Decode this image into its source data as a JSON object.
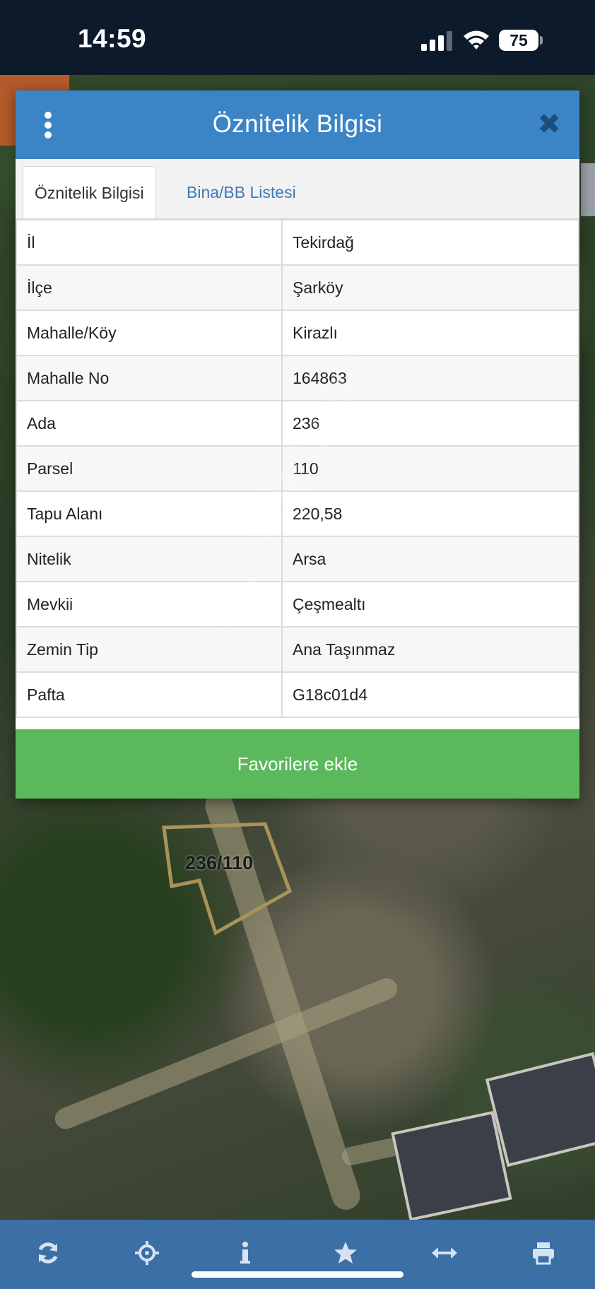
{
  "status_bar": {
    "time": "14:59",
    "battery": "75"
  },
  "modal": {
    "title": "Öznitelik Bilgisi",
    "tabs": [
      {
        "label": "Öznitelik Bilgisi",
        "active": true
      },
      {
        "label": "Bina/BB Listesi",
        "active": false
      }
    ],
    "rows": [
      {
        "key": "İl",
        "value": "Tekirdağ"
      },
      {
        "key": "İlçe",
        "value": "Şarköy"
      },
      {
        "key": "Mahalle/Köy",
        "value": "Kirazlı"
      },
      {
        "key": "Mahalle No",
        "value": "164863"
      },
      {
        "key": "Ada",
        "value": "236"
      },
      {
        "key": "Parsel",
        "value": "110"
      },
      {
        "key": "Tapu Alanı",
        "value": "220,58"
      },
      {
        "key": "Nitelik",
        "value": "Arsa"
      },
      {
        "key": "Mevkii",
        "value": "Çeşmealtı"
      },
      {
        "key": "Zemin Tip",
        "value": "Ana Taşınmaz"
      },
      {
        "key": "Pafta",
        "value": "G18c01d4"
      }
    ],
    "favorite_button": "Favorilere ekle"
  },
  "map": {
    "parcel_label": "236/110"
  },
  "watermark": "emlakjet.com",
  "toolbar": {
    "icons": [
      "refresh-icon",
      "locate-icon",
      "info-icon",
      "star-icon",
      "measure-icon",
      "print-icon"
    ]
  },
  "colors": {
    "header": "#3b84c6",
    "favorite": "#5cb85c",
    "toolbar": "#3b6fa6",
    "tab_link": "#3b7ab8"
  }
}
